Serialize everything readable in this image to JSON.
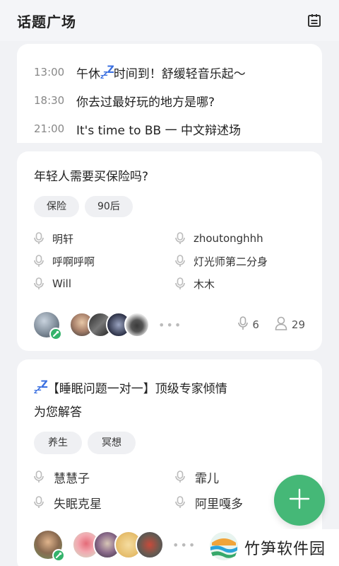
{
  "header": {
    "title": "话题广场",
    "calendar_icon": "calendar-icon"
  },
  "schedule": [
    {
      "time": "13:00",
      "title_before": "午休",
      "title_after": "时间到！舒缓轻音乐起～",
      "has_zzz": true
    },
    {
      "time": "18:30",
      "title_before": "你去过最好玩的地方是哪?",
      "title_after": "",
      "has_zzz": false
    },
    {
      "time": "21:00",
      "title_before": "It's time to BB 一 中文辩述场",
      "title_after": "",
      "has_zzz": false
    }
  ],
  "topics": [
    {
      "title": "年轻人需要买保险吗?",
      "tags": [
        "保险",
        "90后"
      ],
      "speakers": [
        "明轩",
        "zhoutonghhh",
        "呼啊呼啊",
        "灯光师第二分身",
        "Will",
        "木木"
      ],
      "speaker_count": "6",
      "listener_count": "29"
    },
    {
      "title_line1": "【睡眠问题一对一】顶级专家倾情",
      "title_line2": "为您解答",
      "tags": [
        "养生",
        "冥想"
      ],
      "speakers": [
        "慧慧子",
        "霏儿",
        "失眠克星",
        "阿里嘎多"
      ]
    }
  ],
  "zzz": {
    "z1": "z",
    "z2": "z",
    "z3": "Z"
  },
  "more": "•••",
  "fab_icon": "plus-icon",
  "watermark": {
    "text": "竹笋软件园",
    "logo": "bamboo-logo"
  },
  "colors": {
    "accent": "#45b877",
    "zzz": "#3a6fe0",
    "background": "#f1f2f5"
  }
}
